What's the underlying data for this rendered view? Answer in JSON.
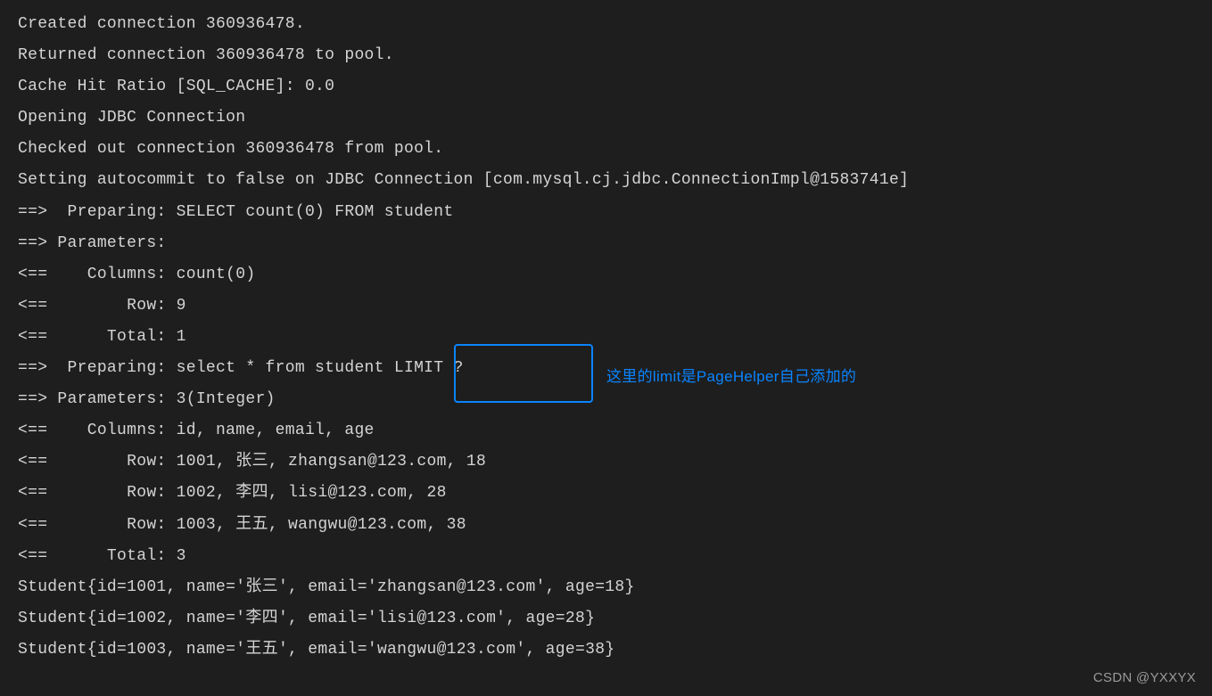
{
  "log": {
    "lines": [
      "Created connection 360936478.",
      "Returned connection 360936478 to pool.",
      "Cache Hit Ratio [SQL_CACHE]: 0.0",
      "Opening JDBC Connection",
      "Checked out connection 360936478 from pool.",
      "Setting autocommit to false on JDBC Connection [com.mysql.cj.jdbc.ConnectionImpl@1583741e]",
      "==>  Preparing: SELECT count(0) FROM student",
      "==> Parameters:",
      "<==    Columns: count(0)",
      "<==        Row: 9",
      "<==      Total: 1",
      "==>  Preparing: select * from student LIMIT ?",
      "==> Parameters: 3(Integer)",
      "<==    Columns: id, name, email, age",
      "<==        Row: 1001, 张三, zhangsan@123.com, 18",
      "<==        Row: 1002, 李四, lisi@123.com, 28",
      "<==        Row: 1003, 王五, wangwu@123.com, 38",
      "<==      Total: 3",
      "Student{id=1001, name='张三', email='zhangsan@123.com', age=18}",
      "Student{id=1002, name='李四', email='lisi@123.com', age=28}",
      "Student{id=1003, name='王五', email='wangwu@123.com', age=38}"
    ]
  },
  "annotation": {
    "text": "这里的limit是PageHelper自己添加的"
  },
  "watermark": "CSDN @YXXYX"
}
